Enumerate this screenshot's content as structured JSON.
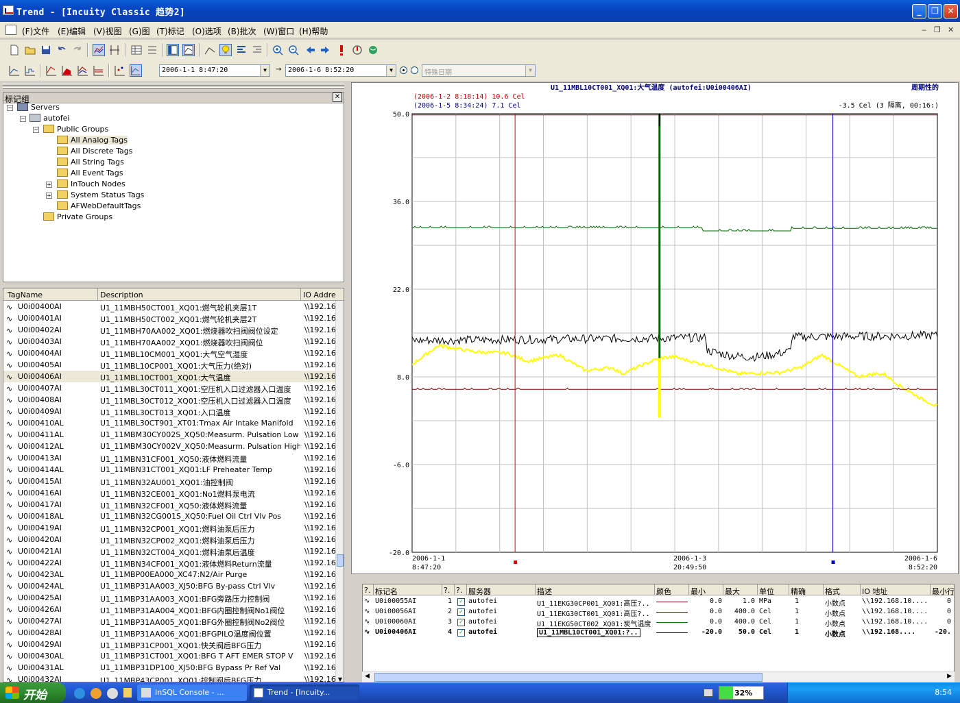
{
  "window": {
    "title": "Trend - [Incuity Classic 趋势2]"
  },
  "menu": [
    {
      "label": "(F)文件"
    },
    {
      "label": "(E)编辑"
    },
    {
      "label": "(V)视图"
    },
    {
      "label": "(G)图"
    },
    {
      "label": "(T)标记"
    },
    {
      "label": "(O)选项"
    },
    {
      "label": "(B)批次"
    },
    {
      "label": "(W)窗口"
    },
    {
      "label": "(H)帮助"
    }
  ],
  "timebar": {
    "start": "2006-1-1  8:47:20",
    "end": "2006-1-6  8:52:20",
    "arrow": "→",
    "special_date_placeholder": "特殊日期"
  },
  "tree": {
    "title": "标记组",
    "close": "✕",
    "nodes": [
      {
        "label": "Servers"
      },
      {
        "label": "autofei"
      },
      {
        "label": "Public Groups"
      },
      {
        "label": "All Analog Tags"
      },
      {
        "label": "All Discrete Tags"
      },
      {
        "label": "All String Tags"
      },
      {
        "label": "All Event Tags"
      },
      {
        "label": "InTouch Nodes"
      },
      {
        "label": "System Status Tags"
      },
      {
        "label": "AFWebDefaultTags"
      },
      {
        "label": "Private Groups"
      }
    ]
  },
  "taglist": {
    "headers": {
      "name": "TagName",
      "desc": "Description",
      "io": "IO Addre"
    },
    "rows": [
      {
        "name": "U0i00400AI",
        "desc": "U1_11MBH50CT001_XQ01:燃气轮机夹层1T",
        "io": "\\\\192.16"
      },
      {
        "name": "U0i00401AI",
        "desc": "U1_11MBH50CT002_XQ01:燃气轮机夹层2T",
        "io": "\\\\192.16"
      },
      {
        "name": "U0i00402AI",
        "desc": "U1_11MBH70AA002_XQ01:燃烧器吹扫阀阀位设定",
        "io": "\\\\192.16"
      },
      {
        "name": "U0i00403AI",
        "desc": "U1_11MBH70AA002_XQ01:燃烧器吹扫阀阀位",
        "io": "\\\\192.16"
      },
      {
        "name": "U0i00404AI",
        "desc": "U1_11MBL10CM001_XQ01:大气空气湿度",
        "io": "\\\\192.16"
      },
      {
        "name": "U0i00405AI",
        "desc": "U1_11MBL10CP001_XQ01:大气压力(绝对)",
        "io": "\\\\192.16"
      },
      {
        "name": "U0i00406AI",
        "desc": "U1_11MBL10CT001_XQ01:大气温度",
        "io": "\\\\192.16"
      },
      {
        "name": "U0i00407AI",
        "desc": "U1_11MBL30CT011_XQ01:空压机入口过滤器入口温度",
        "io": "\\\\192.16"
      },
      {
        "name": "U0i00408AI",
        "desc": "U1_11MBL30CT012_XQ01:空压机入口过滤器入口温度",
        "io": "\\\\192.16"
      },
      {
        "name": "U0i00409AI",
        "desc": "U1_11MBL30CT013_XQ01:入口温度",
        "io": "\\\\192.16"
      },
      {
        "name": "U0i00410AL",
        "desc": "U1_11MBL30CT901_XT01:Tmax Air Intake Manifold",
        "io": "\\\\192.16"
      },
      {
        "name": "U0i00411AL",
        "desc": "U1_11MBM30CY002S_XQ50:Measurm. Pulsation Low",
        "io": "\\\\192.16"
      },
      {
        "name": "U0i00412AL",
        "desc": "U1_11MBM30CY002V_XQ50:Measurm. Pulsation High",
        "io": "\\\\192.16"
      },
      {
        "name": "U0i00413AI",
        "desc": "U1_11MBN31CF001_XQ50:液体燃料流量",
        "io": "\\\\192.16"
      },
      {
        "name": "U0i00414AL",
        "desc": "U1_11MBN31CT001_XQ01:LF Preheater Temp",
        "io": "\\\\192.16"
      },
      {
        "name": "U0i00415AI",
        "desc": "U1_11MBN32AU001_XQ01:油控制阀",
        "io": "\\\\192.16"
      },
      {
        "name": "U0i00416AI",
        "desc": "U1_11MBN32CE001_XQ01:No1燃料泵电流",
        "io": "\\\\192.16"
      },
      {
        "name": "U0i00417AI",
        "desc": "U1_11MBN32CF001_XQ50:液体燃料流量",
        "io": "\\\\192.16"
      },
      {
        "name": "U0i00418AL",
        "desc": "U1_11MBN32CG001S_XQ50:Fuel Oil Ctrl Vlv Pos",
        "io": "\\\\192.16"
      },
      {
        "name": "U0i00419AI",
        "desc": "U1_11MBN32CP001_XQ01:燃料油泵后压力",
        "io": "\\\\192.16"
      },
      {
        "name": "U0i00420AI",
        "desc": "U1_11MBN32CP002_XQ01:燃料油泵后压力",
        "io": "\\\\192.16"
      },
      {
        "name": "U0i00421AI",
        "desc": "U1_11MBN32CT004_XQ01:燃料油泵后温度",
        "io": "\\\\192.16"
      },
      {
        "name": "U0i00422AI",
        "desc": "U1_11MBN34CF001_XQ01:液体燃料Return流量",
        "io": "\\\\192.16"
      },
      {
        "name": "U0i00423AL",
        "desc": "U1_11MBP00EA000_XC47:N2/Air Purge",
        "io": "\\\\192.16"
      },
      {
        "name": "U0i00424AL",
        "desc": "U1_11MBP31AA003_XJ50:BFG By-pass Ctrl Vlv",
        "io": "\\\\192.16"
      },
      {
        "name": "U0i00425AI",
        "desc": "U1_11MBP31AA003_XQ01:BFG旁路压力控制阀",
        "io": "\\\\192.16"
      },
      {
        "name": "U0i00426AI",
        "desc": "U1_11MBP31AA004_XQ01:BFG内圈控制阀No1阀位",
        "io": "\\\\192.16"
      },
      {
        "name": "U0i00427AI",
        "desc": "U1_11MBP31AA005_XQ01:BFG外圈控制阀No2阀位",
        "io": "\\\\192.16"
      },
      {
        "name": "U0i00428AI",
        "desc": "U1_11MBP31AA006_XQ01:BFGPILO温度阀位置",
        "io": "\\\\192.16"
      },
      {
        "name": "U0i00429AI",
        "desc": "U1_11MBP31CP001_XQ01:快关阀后BFG压力",
        "io": "\\\\192.16"
      },
      {
        "name": "U0i00430AL",
        "desc": "U1_11MBP31CT001_XQ01:BFG T AFT EMER STOP V",
        "io": "\\\\192.16"
      },
      {
        "name": "U0i00431AL",
        "desc": "U1_11MBP31DP100_XJ50:BFG Bypass Pr Ref Val",
        "io": "\\\\192.16"
      },
      {
        "name": "U0i00432AI",
        "desc": "U1_11MBP43CP001_XQ01:控制阀后BFG压力",
        "io": "\\\\192.16"
      }
    ]
  },
  "chart_data": {
    "type": "line",
    "title": "U1_11MBL10CT001_XQ01:大气温度 (autofei:U0i00406AI)",
    "top_right": "周期性的",
    "cursor1_label": "(2006-1-2 8:18:14)  10.6 Cel",
    "cursor2_label": "(2006-1-5 8:34:24)  7.1 Cel",
    "delta_label": "-3.5 Cel (3 隔离, 00:16:)",
    "ylim": [
      -20,
      50
    ],
    "yticks": [
      "50.0",
      "36.0",
      "22.0",
      "8.0",
      "-6.0",
      "-20.0"
    ],
    "x_ticks": [
      {
        "date": "2006-1-1",
        "time": "8:47:20"
      },
      {
        "date": "2006-1-3",
        "time": "20:49:50"
      },
      {
        "date": "2006-1-6",
        "time": "8:52:20"
      }
    ],
    "cursor1_frac": 0.196,
    "cursor2_frac": 0.801,
    "now_frac": 0.471,
    "series": [
      {
        "color": "#006400",
        "approx_level": 31.8
      },
      {
        "color": "#000000",
        "approx_level": 14.0
      },
      {
        "color": "#ffff00",
        "approx_level": 9.0
      },
      {
        "color": "#800000",
        "approx_level": 6.0
      }
    ]
  },
  "pens": {
    "headers": [
      "?.",
      "标记名",
      "?.",
      "?.",
      "服务器",
      "描述",
      "颜色",
      "最小",
      "最大",
      "单位",
      "精确",
      "格式",
      "IO 地址",
      "最小行"
    ],
    "rows": [
      {
        "name": "U0i00055AI",
        "idx": "1",
        "server": "autofei",
        "desc": "U1_11EKG30CP001_XQ01:高压?..",
        "color": "#800000",
        "min": "0.0",
        "max": "1.0",
        "unit": "MPa",
        "prec": "1",
        "fmt": "小数点",
        "io": "\\\\192.168.10....",
        "minrow": "0",
        "bold": false
      },
      {
        "name": "U0i00056AI",
        "idx": "2",
        "server": "autofei",
        "desc": "U1_11EKG30CT001_XQ01:高压?..",
        "color": "#800000",
        "min": "0.0",
        "max": "400.0",
        "unit": "Cel",
        "prec": "1",
        "fmt": "小数点",
        "io": "\\\\192.168.10....",
        "minrow": "0",
        "bold": false
      },
      {
        "name": "U0i00060AI",
        "idx": "3",
        "server": "autofei",
        "desc": "U1_11EKG50CT002_XQ01:炭气温度",
        "color": "#008000",
        "min": "0.0",
        "max": "400.0",
        "unit": "Cel",
        "prec": "1",
        "fmt": "小数点",
        "io": "\\\\192.168.10....",
        "minrow": "0",
        "bold": false
      },
      {
        "name": "U0i00406AI",
        "idx": "4",
        "server": "autofei",
        "desc": "U1_11MBL10CT001_XQ01:?..",
        "color": "#000000",
        "min": "-20.0",
        "max": "50.0",
        "unit": "Cel",
        "prec": "1",
        "fmt": "小数点",
        "io": "\\\\192.168....",
        "minrow": "-20.",
        "bold": true
      }
    ]
  },
  "taskbar": {
    "start": "开始",
    "tasks": [
      {
        "label": "InSQL Console - ..."
      },
      {
        "label": "Trend - [Incuity..."
      }
    ],
    "battery": "32%",
    "battery_frac": 0.32,
    "clock": "8:54"
  }
}
